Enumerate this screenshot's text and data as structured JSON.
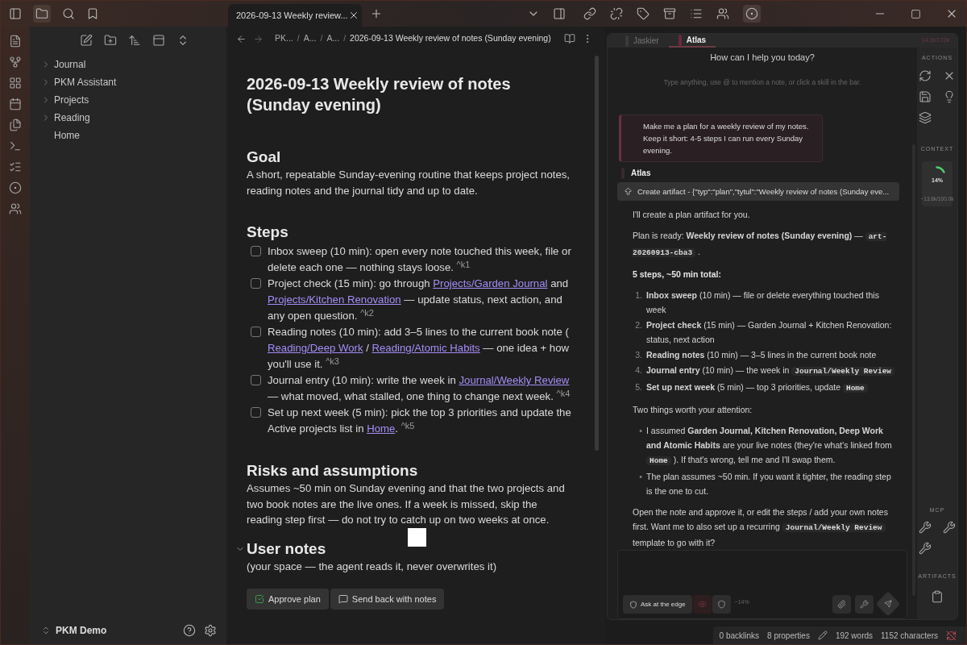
{
  "tab": {
    "title": "2026-09-13 Weekly review...",
    "selected": true
  },
  "sidebar": {
    "items": [
      {
        "label": "Journal",
        "kind": "folder"
      },
      {
        "label": "PKM Assistant",
        "kind": "folder"
      },
      {
        "label": "Projects",
        "kind": "folder"
      },
      {
        "label": "Reading",
        "kind": "folder"
      },
      {
        "label": "Home",
        "kind": "file"
      }
    ],
    "vault": "PKM Demo"
  },
  "breadcrumb": {
    "separator": "/",
    "items": [
      "PK...",
      "A...",
      "A...",
      "2026-09-13 Weekly review of notes (Sunday evening)"
    ]
  },
  "note": {
    "title": "2026-09-13 Weekly review of notes (Sunday evening)",
    "sections": [
      {
        "heading": "Goal",
        "kind": "paragraph",
        "text": "A short, repeatable Sunday-evening routine that keeps project notes, reading notes and the journal tidy and up to date."
      },
      {
        "heading": "Steps",
        "kind": "tasks",
        "tasks": [
          {
            "checked": false,
            "segments": [
              {
                "kind": "text",
                "text": "Inbox sweep (10 min): open every note touched this week, file or delete each one — nothing stays loose. "
              },
              {
                "kind": "ref",
                "text": "^k1"
              }
            ]
          },
          {
            "checked": false,
            "segments": [
              {
                "kind": "text",
                "text": "Project check (15 min): go through "
              },
              {
                "kind": "link",
                "text": "Projects/Garden Journal"
              },
              {
                "kind": "text",
                "text": " and "
              },
              {
                "kind": "link",
                "text": "Projects/Kitchen Renovation"
              },
              {
                "kind": "text",
                "text": " — update status, next action, and any open question. "
              },
              {
                "kind": "ref",
                "text": "^k2"
              }
            ]
          },
          {
            "checked": false,
            "segments": [
              {
                "kind": "text",
                "text": "Reading notes (10 min): add 3–5 lines to the current book note ( "
              },
              {
                "kind": "link",
                "text": "Reading/Deep Work"
              },
              {
                "kind": "text",
                "text": " / "
              },
              {
                "kind": "link",
                "text": "Reading/Atomic Habits"
              },
              {
                "kind": "text",
                "text": " — one idea + how you'll use it. "
              },
              {
                "kind": "ref",
                "text": "^k3"
              }
            ]
          },
          {
            "checked": false,
            "segments": [
              {
                "kind": "text",
                "text": "Journal entry (10 min): write the week in "
              },
              {
                "kind": "link",
                "text": "Journal/Weekly Review"
              },
              {
                "kind": "text",
                "text": " — what moved, what stalled, one thing to change next week. "
              },
              {
                "kind": "ref",
                "text": "^k4"
              }
            ]
          },
          {
            "checked": false,
            "segments": [
              {
                "kind": "text",
                "text": "Set up next week (5 min): pick the top 3 priorities and update the Active projects list in "
              },
              {
                "kind": "link",
                "text": "Home"
              },
              {
                "kind": "text",
                "text": ". "
              },
              {
                "kind": "ref",
                "text": "^k5"
              }
            ]
          }
        ]
      },
      {
        "heading": "Risks and assumptions",
        "kind": "paragraph",
        "text": "Assumes ~50 min on Sunday evening and that the two projects and two book notes are the live ones. If a week is missed, skip the reading step first — do not try to catch up on two weeks at once."
      },
      {
        "heading": "User notes",
        "kind": "collapsible",
        "expanded": true,
        "text": "(your space — the agent reads it, never overwrites it)"
      }
    ],
    "buttons": [
      {
        "label": "Approve plan",
        "kind": "approve"
      },
      {
        "label": "Send back with notes",
        "kind": "comment"
      }
    ]
  },
  "chat": {
    "tabs": [
      {
        "label": "Jaskier",
        "selected": false
      },
      {
        "label": "Atlas",
        "selected": true
      }
    ],
    "tokens": "14.1k/172k",
    "greeting": "How can I help you today?",
    "hint": "Type anything, use @ to mention a note, or click a skill in the bar.",
    "user_message": "Make me a plan for a weekly review of my notes. Keep it short: 4-5 steps I can run every Sunday evening.",
    "assistant_name": "Atlas",
    "tool_call": "Create artifact - {\"typ\":\"plan\",\"tytul\":\"Weekly review of notes (Sunday eve...",
    "blocks": [
      {
        "kind": "paragraph",
        "segments": [
          {
            "kind": "text",
            "text": "I'll create a plan artifact for you."
          }
        ]
      },
      {
        "kind": "paragraph",
        "segments": [
          {
            "kind": "text",
            "text": "Plan is ready: **Weekly review of notes (Sunday evening)** — "
          },
          {
            "kind": "code",
            "text": "art-20260913-cba3"
          },
          {
            "kind": "text",
            "text": " ."
          }
        ]
      },
      {
        "kind": "strong",
        "segments": [
          {
            "kind": "text",
            "text": "5 steps, ~50 min total:"
          }
        ]
      },
      {
        "kind": "ordered",
        "items": [
          {
            "marker": "1.",
            "segments": [
              {
                "kind": "text",
                "text": "**Inbox sweep** (10 min) — file or delete everything touched this week"
              }
            ]
          },
          {
            "marker": "2.",
            "segments": [
              {
                "kind": "text",
                "text": "**Project check** (15 min) — Garden Journal + Kitchen Renovation: status, next action"
              }
            ]
          },
          {
            "marker": "3.",
            "segments": [
              {
                "kind": "text",
                "text": "**Reading notes** (10 min) — 3–5 lines in the current book note"
              }
            ]
          },
          {
            "marker": "4.",
            "segments": [
              {
                "kind": "text",
                "text": "**Journal entry** (10 min) — the week in "
              },
              {
                "kind": "code",
                "text": "Journal/Weekly Review"
              }
            ]
          },
          {
            "marker": "5.",
            "segments": [
              {
                "kind": "text",
                "text": "**Set up next week** (5 min) — top 3 priorities, update "
              },
              {
                "kind": "code",
                "text": "Home"
              }
            ]
          }
        ]
      },
      {
        "kind": "paragraph",
        "segments": [
          {
            "kind": "text",
            "text": "Two things worth your attention:"
          }
        ]
      },
      {
        "kind": "bullets",
        "items": [
          {
            "marker": "•",
            "segments": [
              {
                "kind": "text",
                "text": "I assumed **Garden Journal, Kitchen Renovation, Deep Work and Atomic Habits** are your live notes (they're what's linked from "
              },
              {
                "kind": "code",
                "text": "Home"
              },
              {
                "kind": "text",
                "text": " ). If that's wrong, tell me and I'll swap them."
              }
            ]
          },
          {
            "marker": "•",
            "segments": [
              {
                "kind": "text",
                "text": "The plan assumes ~50 min. If you want it tighter, the reading step is the one to cut."
              }
            ]
          }
        ]
      },
      {
        "kind": "paragraph",
        "segments": [
          {
            "kind": "text",
            "text": "Open the note and approve it, or edit the steps / add your own notes first. Want me to also set up a recurring "
          },
          {
            "kind": "code",
            "text": "Journal/Weekly Review"
          },
          {
            "kind": "text",
            "text": " template to go with it?"
          }
        ]
      }
    ],
    "input": {
      "edge_button": "Ask at the edge",
      "eye_on": true,
      "usage": "~14%"
    },
    "rail": {
      "actions_label": "ACTIONS",
      "context_label": "CONTEXT",
      "context_percent": "14%",
      "context_tokens": "~13.8k/100.0k",
      "mcp_label": "MCP",
      "artifacts_label": "ARTIFACTS"
    }
  },
  "status_bar": {
    "backlinks": "0 backlinks",
    "properties": "8 properties",
    "words": "192 words",
    "characters": "1152 characters"
  }
}
